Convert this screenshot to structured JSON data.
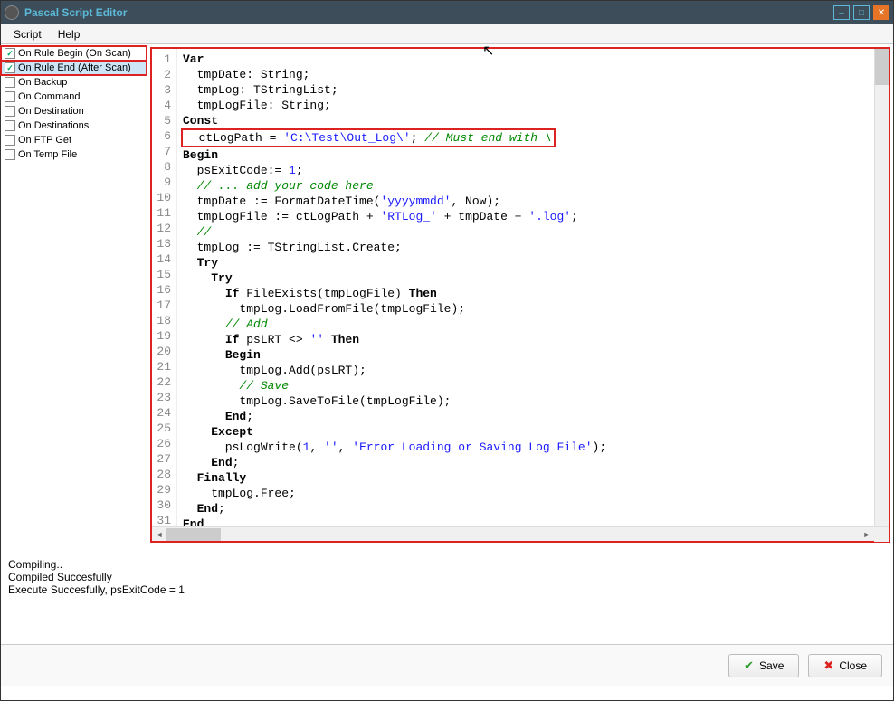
{
  "window": {
    "title": "Pascal Script Editor"
  },
  "menu": {
    "script": "Script",
    "help": "Help"
  },
  "sidebar": {
    "items": [
      {
        "label": "On Rule Begin (On Scan)",
        "checked": true,
        "highlighted": true
      },
      {
        "label": "On Rule End (After Scan)",
        "checked": true,
        "selected": true
      },
      {
        "label": "On Backup",
        "checked": false
      },
      {
        "label": "On Command",
        "checked": false
      },
      {
        "label": "On Destination",
        "checked": false
      },
      {
        "label": "On Destinations",
        "checked": false
      },
      {
        "label": "On FTP Get",
        "checked": false
      },
      {
        "label": "On Temp File",
        "checked": false
      }
    ]
  },
  "code": {
    "lines": [
      {
        "n": 1,
        "t": [
          [
            "kw",
            "Var"
          ]
        ]
      },
      {
        "n": 2,
        "t": [
          [
            "",
            "  tmpDate: String;"
          ]
        ]
      },
      {
        "n": 3,
        "t": [
          [
            "",
            "  tmpLog: TStringList;"
          ]
        ]
      },
      {
        "n": 4,
        "t": [
          [
            "",
            "  tmpLogFile: String;"
          ]
        ]
      },
      {
        "n": 5,
        "t": [
          [
            "kw",
            "Const"
          ]
        ]
      },
      {
        "n": 6,
        "hl": true,
        "t": [
          [
            "",
            "  ctLogPath = "
          ],
          [
            "str",
            "'C:\\Test\\Out_Log\\'"
          ],
          [
            "",
            "; "
          ],
          [
            "com",
            "// Must end with \\"
          ]
        ]
      },
      {
        "n": 7,
        "t": [
          [
            "kw",
            "Begin"
          ]
        ]
      },
      {
        "n": 8,
        "t": [
          [
            "",
            "  psExitCode:= "
          ],
          [
            "num",
            "1"
          ],
          [
            "",
            ";"
          ]
        ]
      },
      {
        "n": 9,
        "t": [
          [
            "",
            "  "
          ],
          [
            "com",
            "// ... add your code here"
          ]
        ]
      },
      {
        "n": 10,
        "t": [
          [
            "",
            "  tmpDate := FormatDateTime("
          ],
          [
            "str",
            "'yyyymmdd'"
          ],
          [
            "",
            ", Now);"
          ]
        ]
      },
      {
        "n": 11,
        "t": [
          [
            "",
            "  tmpLogFile := ctLogPath + "
          ],
          [
            "str",
            "'RTLog_'"
          ],
          [
            "",
            " + tmpDate + "
          ],
          [
            "str",
            "'.log'"
          ],
          [
            "",
            ";"
          ]
        ]
      },
      {
        "n": 12,
        "t": [
          [
            "",
            "  "
          ],
          [
            "com",
            "//"
          ]
        ]
      },
      {
        "n": 13,
        "t": [
          [
            "",
            "  tmpLog := TStringList.Create;"
          ]
        ]
      },
      {
        "n": 14,
        "t": [
          [
            "",
            "  "
          ],
          [
            "kw",
            "Try"
          ]
        ]
      },
      {
        "n": 15,
        "t": [
          [
            "",
            "    "
          ],
          [
            "kw",
            "Try"
          ]
        ]
      },
      {
        "n": 16,
        "t": [
          [
            "",
            "      "
          ],
          [
            "kw",
            "If"
          ],
          [
            "",
            " FileExists(tmpLogFile) "
          ],
          [
            "kw",
            "Then"
          ]
        ]
      },
      {
        "n": 17,
        "t": [
          [
            "",
            "        tmpLog.LoadFromFile(tmpLogFile);"
          ]
        ]
      },
      {
        "n": 18,
        "t": [
          [
            "",
            "      "
          ],
          [
            "com",
            "// Add"
          ]
        ]
      },
      {
        "n": 19,
        "t": [
          [
            "",
            "      "
          ],
          [
            "kw",
            "If"
          ],
          [
            "",
            " psLRT <> "
          ],
          [
            "str",
            "''"
          ],
          [
            "",
            " "
          ],
          [
            "kw",
            "Then"
          ]
        ]
      },
      {
        "n": 20,
        "t": [
          [
            "",
            "      "
          ],
          [
            "kw",
            "Begin"
          ]
        ]
      },
      {
        "n": 21,
        "t": [
          [
            "",
            "        tmpLog.Add(psLRT);"
          ]
        ]
      },
      {
        "n": 22,
        "t": [
          [
            "",
            "        "
          ],
          [
            "com",
            "// Save"
          ]
        ]
      },
      {
        "n": 23,
        "t": [
          [
            "",
            "        tmpLog.SaveToFile(tmpLogFile);"
          ]
        ]
      },
      {
        "n": 24,
        "t": [
          [
            "",
            "      "
          ],
          [
            "kw",
            "End"
          ],
          [
            "",
            ";"
          ]
        ]
      },
      {
        "n": 25,
        "t": [
          [
            "",
            "    "
          ],
          [
            "kw",
            "Except"
          ]
        ]
      },
      {
        "n": 26,
        "t": [
          [
            "",
            "      psLogWrite("
          ],
          [
            "num",
            "1"
          ],
          [
            "",
            ", "
          ],
          [
            "str",
            "''"
          ],
          [
            "",
            ", "
          ],
          [
            "str",
            "'Error Loading or Saving Log File'"
          ],
          [
            "",
            ");"
          ]
        ]
      },
      {
        "n": 27,
        "t": [
          [
            "",
            "    "
          ],
          [
            "kw",
            "End"
          ],
          [
            "",
            ";"
          ]
        ]
      },
      {
        "n": 28,
        "t": [
          [
            "",
            "  "
          ],
          [
            "kw",
            "Finally"
          ]
        ]
      },
      {
        "n": 29,
        "t": [
          [
            "",
            "    tmpLog.Free;"
          ]
        ]
      },
      {
        "n": 30,
        "t": [
          [
            "",
            "  "
          ],
          [
            "kw",
            "End"
          ],
          [
            "",
            ";"
          ]
        ]
      },
      {
        "n": 31,
        "t": [
          [
            "kw",
            "End"
          ],
          [
            "",
            "."
          ]
        ]
      }
    ]
  },
  "output": {
    "line1": "Compiling..",
    "line2": "Compiled Succesfully",
    "line3": "Execute Succesfully, psExitCode = 1"
  },
  "buttons": {
    "save": "Save",
    "close": "Close"
  }
}
